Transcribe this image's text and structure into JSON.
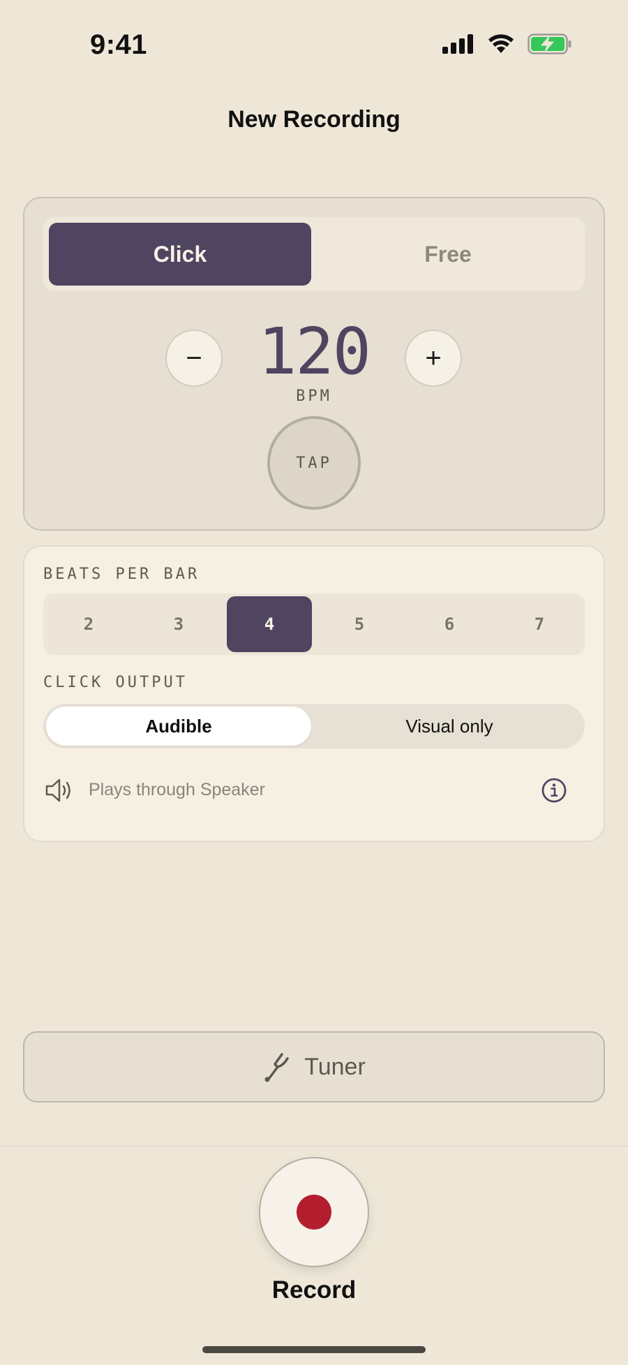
{
  "status_bar": {
    "time": "9:41",
    "signal_icon": "cellular-signal-icon",
    "wifi_icon": "wifi-icon",
    "battery_icon": "battery-charging-icon",
    "battery_color": "#34C759"
  },
  "header": {
    "title": "New Recording"
  },
  "metronome": {
    "mode_options": [
      "Click",
      "Free"
    ],
    "selected_mode": "Click",
    "decrement_symbol": "−",
    "increment_symbol": "+",
    "bpm": "120",
    "bpm_label": "BPM",
    "tap_label": "TAP"
  },
  "settings": {
    "beats_label": "BEATS PER BAR",
    "beats_options": [
      "2",
      "3",
      "4",
      "5",
      "6",
      "7"
    ],
    "beats_selected": "4",
    "output_label": "CLICK OUTPUT",
    "output_options": [
      "Audible",
      "Visual only"
    ],
    "output_selected": "Audible",
    "route_text": "Plays through Speaker",
    "speaker_icon": "speaker-icon",
    "info_icon": "info-icon"
  },
  "tuner": {
    "label": "Tuner",
    "icon": "tuning-fork-icon"
  },
  "record": {
    "label": "Record",
    "icon": "record-dot-icon"
  },
  "colors": {
    "background": "#EEE7D8",
    "accent": "#4F4560",
    "record": "#B31E2E"
  }
}
